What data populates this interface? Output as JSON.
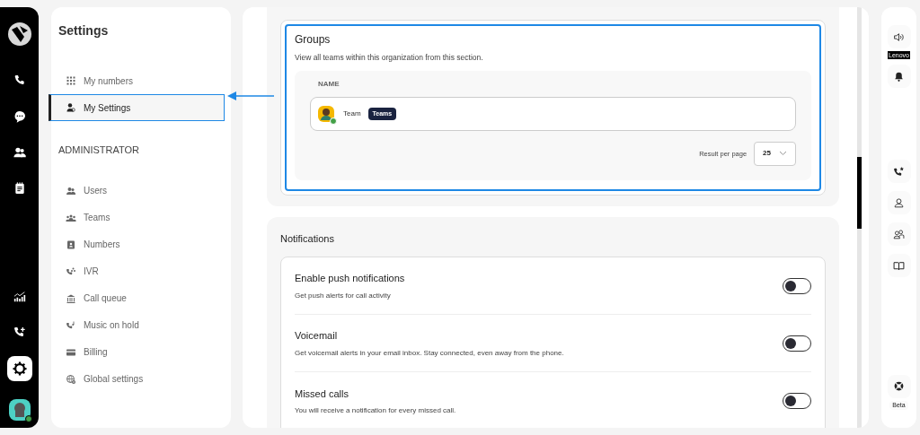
{
  "rail": {
    "items": [
      {
        "kind": "phone",
        "selected": false
      },
      {
        "kind": "chat",
        "selected": false
      },
      {
        "kind": "contacts",
        "selected": false
      },
      {
        "kind": "notes",
        "selected": false
      },
      {
        "kind": "stats",
        "selected": false
      },
      {
        "kind": "phone-plus",
        "selected": false
      },
      {
        "kind": "settings",
        "selected": true
      }
    ],
    "avatar": {
      "online": true
    }
  },
  "settings": {
    "title": "Settings",
    "items": [
      {
        "kind": "grid",
        "label": "My numbers",
        "selected": false
      },
      {
        "kind": "user",
        "label": "My Settings",
        "selected": true
      }
    ],
    "section": "ADMINISTRATOR",
    "admin_items": [
      {
        "kind": "users",
        "label": "Users",
        "selected": false
      },
      {
        "kind": "teams",
        "label": "Teams",
        "selected": false
      },
      {
        "kind": "card",
        "label": "Numbers",
        "selected": false
      },
      {
        "kind": "ivr",
        "label": "IVR",
        "selected": false
      },
      {
        "kind": "queue",
        "label": "Call queue",
        "selected": false
      },
      {
        "kind": "music",
        "label": "Music on hold",
        "selected": false
      },
      {
        "kind": "billing",
        "label": "Billing",
        "selected": false
      },
      {
        "kind": "globe",
        "label": "Global settings",
        "selected": false
      }
    ]
  },
  "groups": {
    "title": "Groups",
    "description": "View all teams within this organization from this section.",
    "columns": [
      "NAME"
    ],
    "rows": [
      {
        "name": "Team",
        "tag": "Teams",
        "online": true
      }
    ],
    "pagination": {
      "label": "Result per page",
      "value": "25"
    }
  },
  "notifications": {
    "title": "Notifications",
    "items": [
      {
        "title": "Enable push notifications",
        "description": "Get push alerts for call activity",
        "on": false
      },
      {
        "title": "Voicemail",
        "description": "Get voicemail alerts in your email inbox. Stay connected, even away from the phone.",
        "on": false
      },
      {
        "title": "Missed calls",
        "description": "You will receive a notification for every missed call.",
        "on": false
      }
    ]
  },
  "right_rail": {
    "top": [
      {
        "kind": "speaker",
        "label": "Lenovo"
      },
      {
        "kind": "bell"
      }
    ],
    "middle": [
      {
        "kind": "phone-star"
      },
      {
        "kind": "person"
      },
      {
        "kind": "people"
      },
      {
        "kind": "book"
      }
    ],
    "bottom": [
      {
        "kind": "help",
        "label": "Beta"
      }
    ]
  }
}
